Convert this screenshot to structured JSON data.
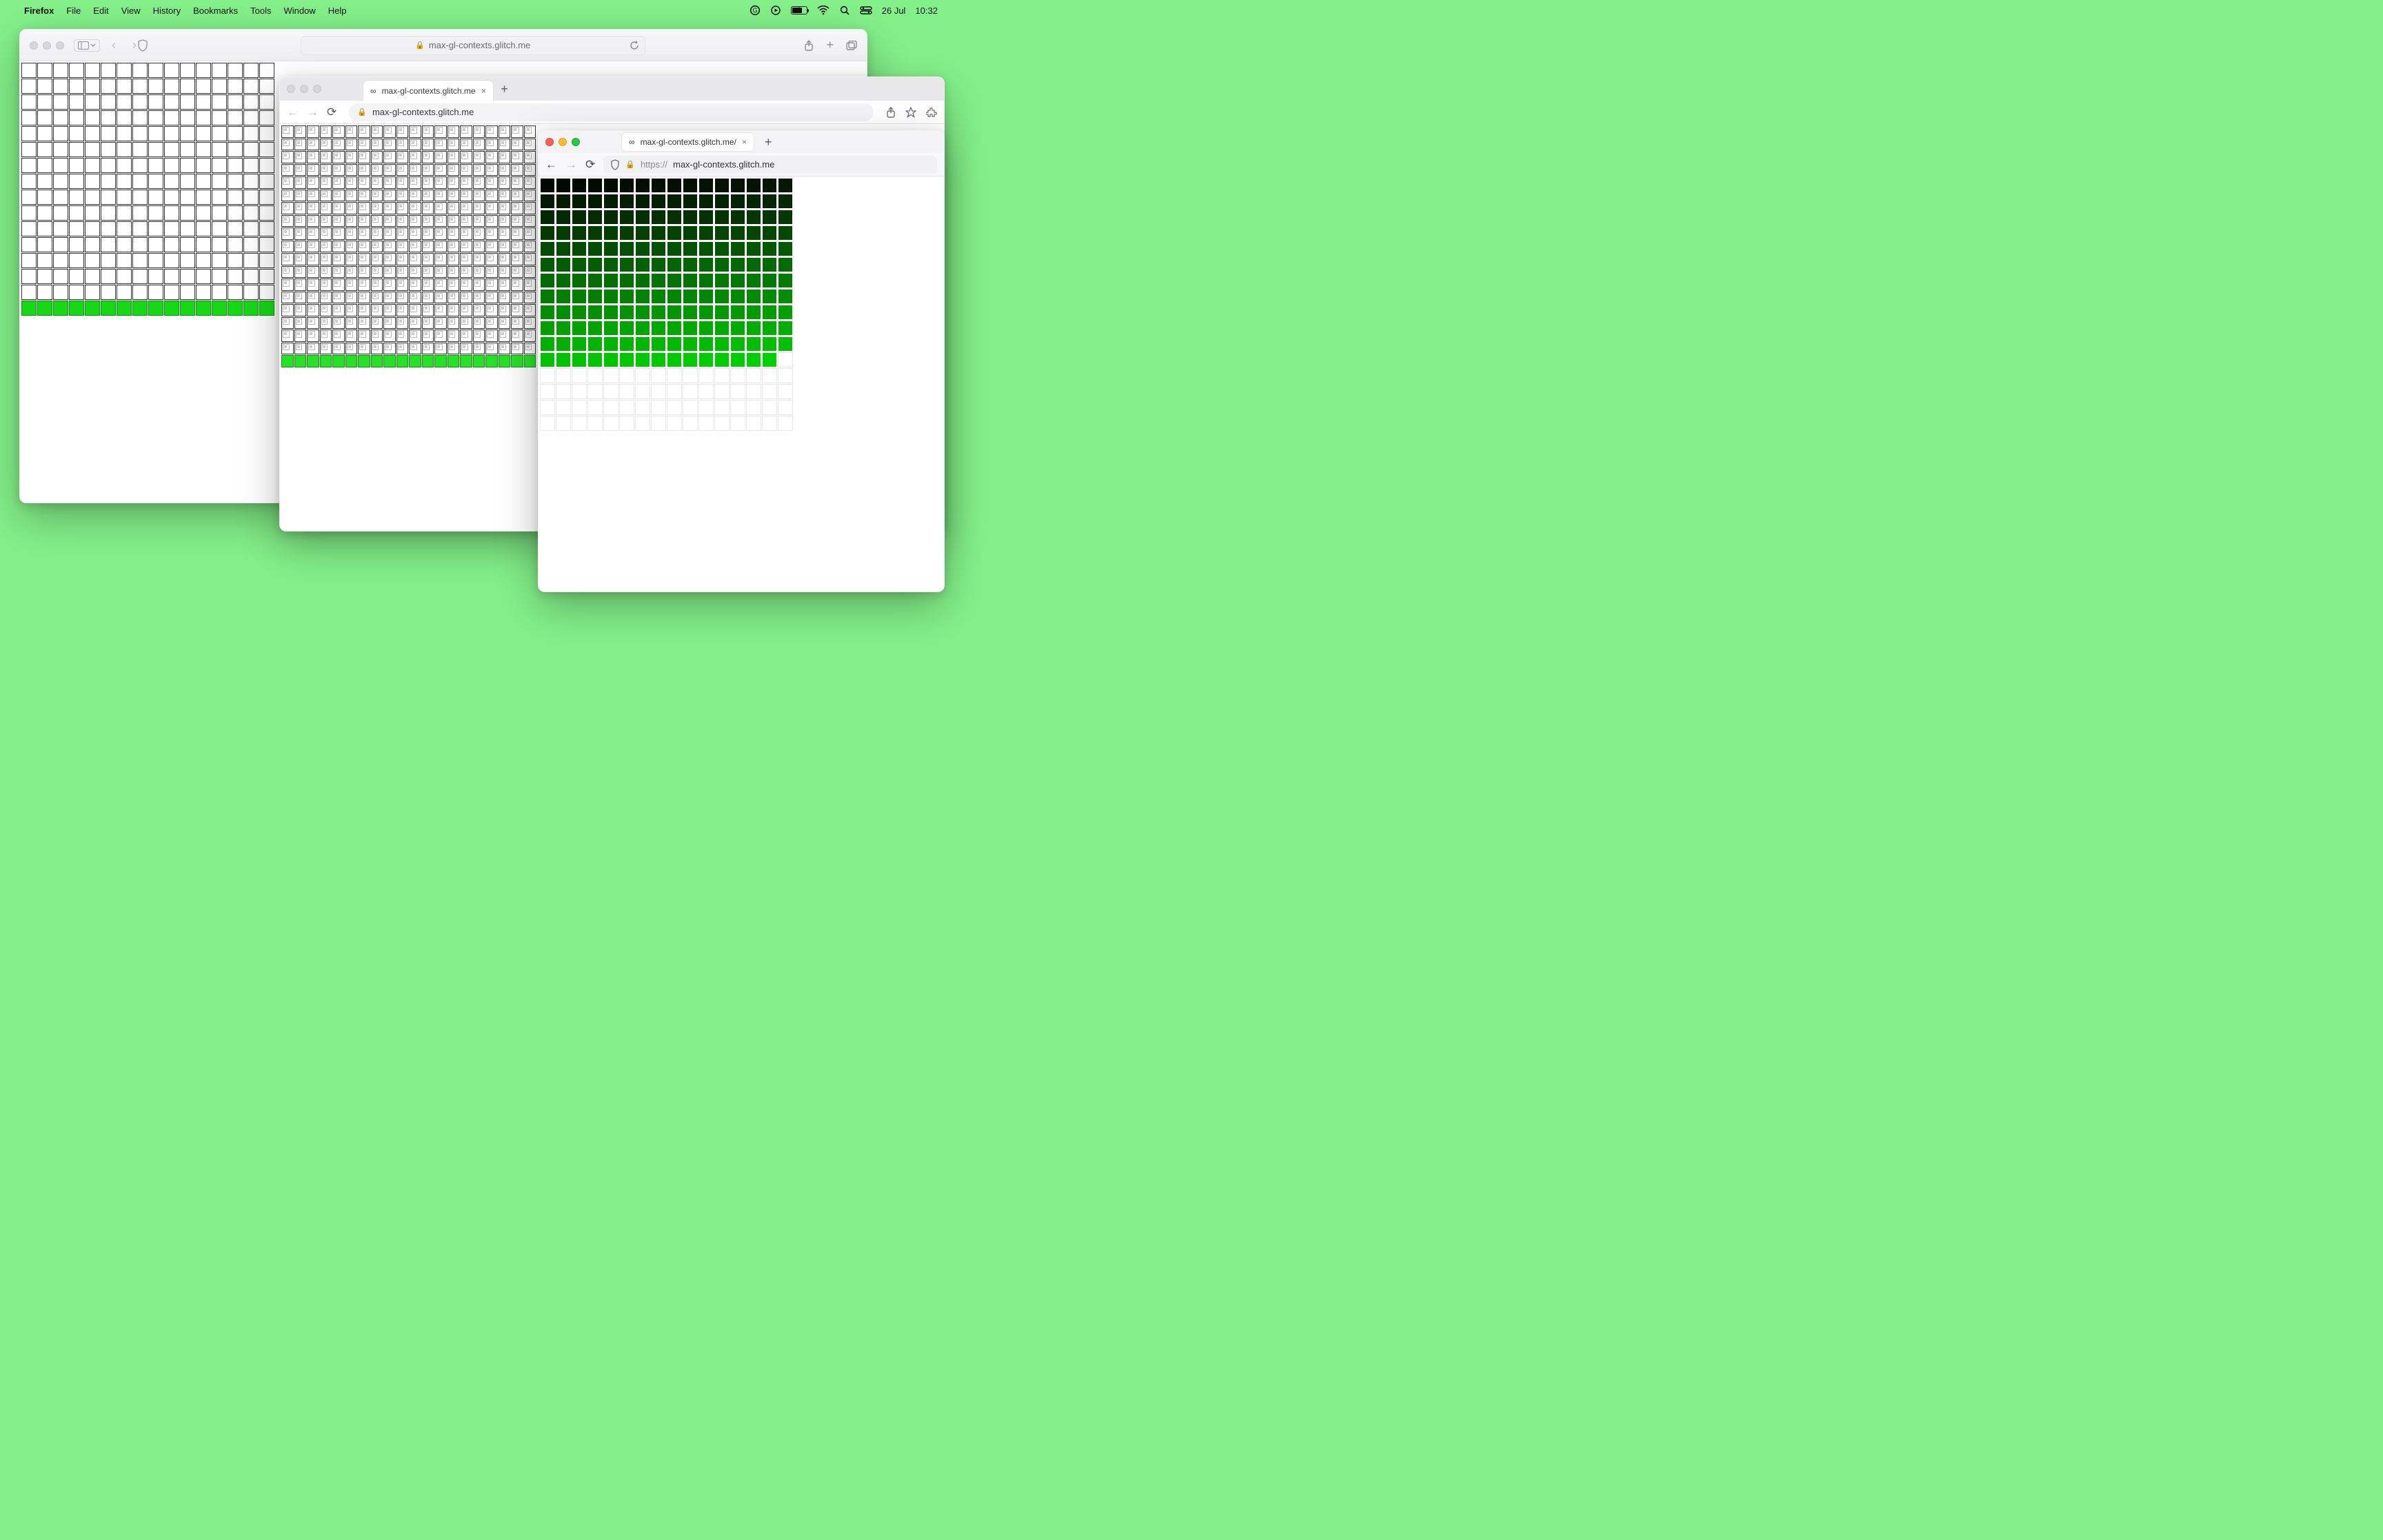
{
  "menubar": {
    "app": "Firefox",
    "items": [
      "File",
      "Edit",
      "View",
      "History",
      "Bookmarks",
      "Tools",
      "Window",
      "Help"
    ],
    "date": "26 Jul",
    "time": "10:32"
  },
  "safari": {
    "url_display": "max-gl-contexts.glitch.me",
    "grid": {
      "cols": 16,
      "rows": 16,
      "green_row_index": 15
    }
  },
  "chrome": {
    "tab_title": "max-gl-contexts.glitch.me",
    "url_display": "max-gl-contexts.glitch.me",
    "grid": {
      "cols": 20,
      "rows": 19,
      "green_row_index": 18
    }
  },
  "firefox": {
    "tab_title": "max-gl-contexts.glitch.me/",
    "url_proto": "https://",
    "url_host": "max-gl-contexts.glitch.me",
    "grid": {
      "cols": 16,
      "rows": 16,
      "filled_count": 191
    }
  }
}
